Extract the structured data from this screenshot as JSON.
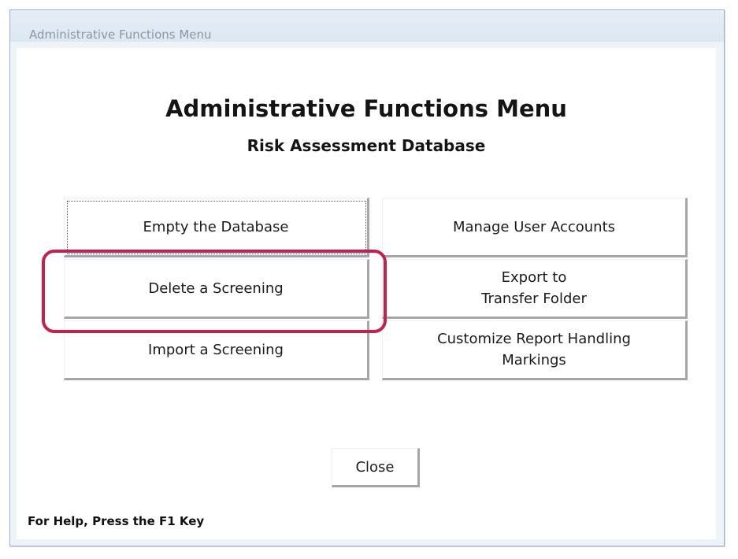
{
  "window": {
    "title": "Administrative Functions Menu"
  },
  "header": {
    "title": "Administrative Functions Menu",
    "subtitle": "Risk Assessment Database"
  },
  "buttons": {
    "empty_database": "Empty the Database",
    "manage_users": "Manage User Accounts",
    "delete_screening": "Delete a Screening",
    "export_transfer": "Export to\nTransfer Folder",
    "import_screening": "Import a Screening",
    "customize_markings": "Customize Report Handling\nMarkings",
    "close": "Close"
  },
  "footer": {
    "help_text": "For Help, Press the F1 Key"
  },
  "colors": {
    "highlight": "#c51f4b",
    "window_frame": "#eef3f8"
  }
}
